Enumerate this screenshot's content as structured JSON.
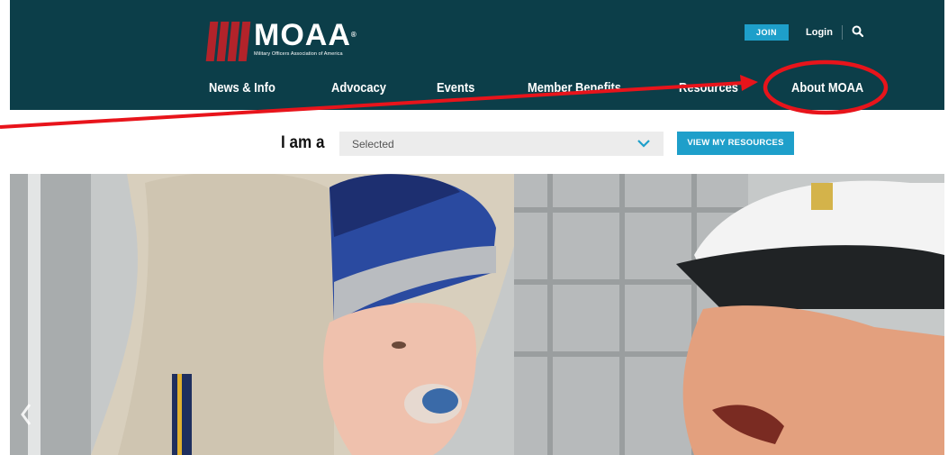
{
  "brand": {
    "name": "MOAA",
    "registered": "®",
    "tagline": "Military Officers Association of America"
  },
  "top_links": {
    "join": "JOIN",
    "login": "Login"
  },
  "nav": {
    "items": [
      "News & Info",
      "Advocacy",
      "Events",
      "Member Benefits",
      "Resources",
      "About MOAA"
    ]
  },
  "selector": {
    "label": "I am a",
    "value": "Selected",
    "button": "VIEW MY RESOURCES"
  },
  "icons": {
    "search": "search-icon",
    "dropdown": "chevron-down-icon",
    "carousel_prev": "chevron-left-icon"
  },
  "colors": {
    "header_bg": "#0c3e49",
    "accent": "#1e9fca",
    "brand_red": "#b3232a",
    "annotation_red": "#e8141b"
  }
}
